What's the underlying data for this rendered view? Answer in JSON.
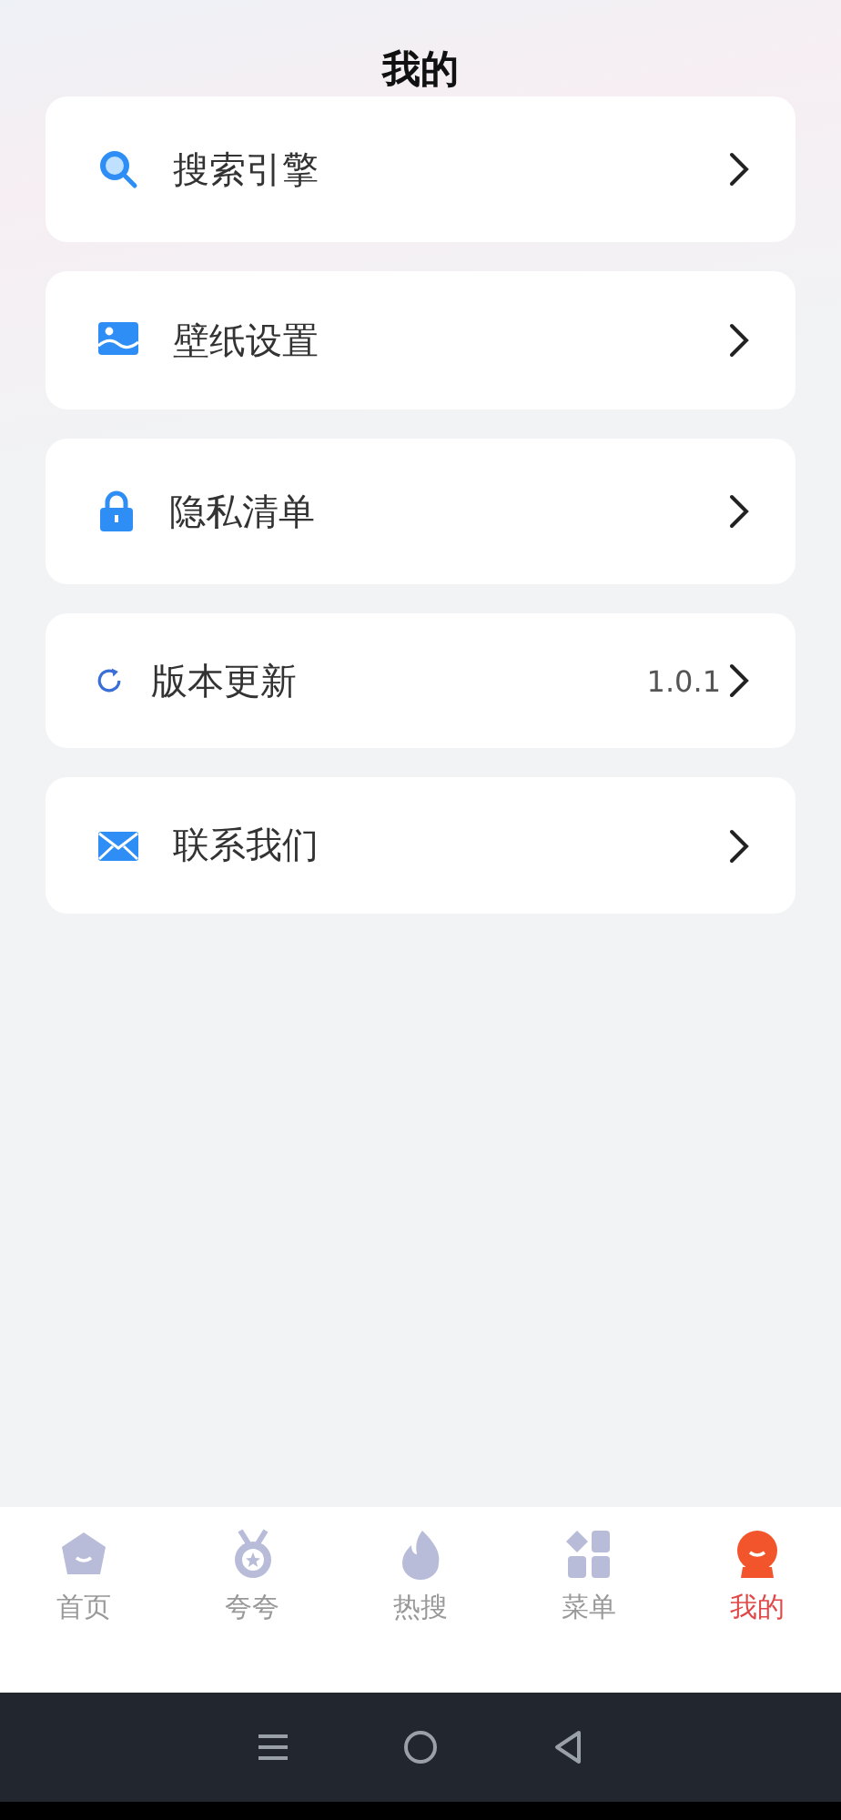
{
  "title": "我的",
  "menu": [
    {
      "label": "搜索引擎"
    },
    {
      "label": "壁纸设置"
    },
    {
      "label": "隐私清单"
    },
    {
      "label": "版本更新",
      "value": "1.0.1"
    },
    {
      "label": "联系我们"
    }
  ],
  "tab_bar": [
    {
      "label": "首页",
      "selected": false
    },
    {
      "label": "夸夸",
      "selected": false
    },
    {
      "label": "热搜",
      "selected": false
    },
    {
      "label": "菜单",
      "selected": false
    },
    {
      "label": "我的",
      "selected": true
    }
  ]
}
